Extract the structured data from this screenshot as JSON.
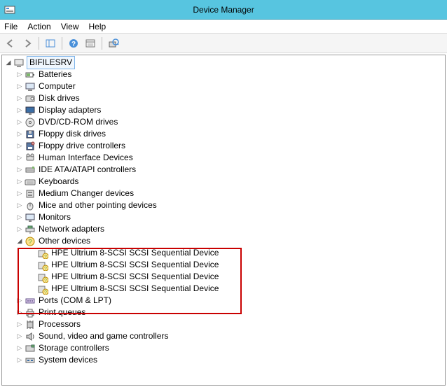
{
  "title": "Device Manager",
  "menu": {
    "file": "File",
    "action": "Action",
    "view": "View",
    "help": "Help"
  },
  "root": "BIFILESRV",
  "categories": [
    {
      "label": "Batteries",
      "icon": "battery",
      "expanded": false
    },
    {
      "label": "Computer",
      "icon": "computer",
      "expanded": false
    },
    {
      "label": "Disk drives",
      "icon": "disk",
      "expanded": false
    },
    {
      "label": "Display adapters",
      "icon": "display",
      "expanded": false
    },
    {
      "label": "DVD/CD-ROM drives",
      "icon": "optical",
      "expanded": false
    },
    {
      "label": "Floppy disk drives",
      "icon": "floppy",
      "expanded": false
    },
    {
      "label": "Floppy drive controllers",
      "icon": "floppyctrl",
      "expanded": false
    },
    {
      "label": "Human Interface Devices",
      "icon": "hid",
      "expanded": false
    },
    {
      "label": "IDE ATA/ATAPI controllers",
      "icon": "ide",
      "expanded": false
    },
    {
      "label": "Keyboards",
      "icon": "keyboard",
      "expanded": false
    },
    {
      "label": "Medium Changer devices",
      "icon": "medium",
      "expanded": false
    },
    {
      "label": "Mice and other pointing devices",
      "icon": "mouse",
      "expanded": false
    },
    {
      "label": "Monitors",
      "icon": "monitor",
      "expanded": false
    },
    {
      "label": "Network adapters",
      "icon": "network",
      "expanded": false
    },
    {
      "label": "Other devices",
      "icon": "other",
      "expanded": true,
      "children": [
        {
          "label": "HPE Ultrium 8-SCSI SCSI Sequential Device",
          "icon": "unknown"
        },
        {
          "label": "HPE Ultrium 8-SCSI SCSI Sequential Device",
          "icon": "unknown"
        },
        {
          "label": "HPE Ultrium 8-SCSI SCSI Sequential Device",
          "icon": "unknown"
        },
        {
          "label": "HPE Ultrium 8-SCSI SCSI Sequential Device",
          "icon": "unknown"
        }
      ]
    },
    {
      "label": "Ports (COM & LPT)",
      "icon": "ports",
      "expanded": false
    },
    {
      "label": "Print queues",
      "icon": "print",
      "expanded": false
    },
    {
      "label": "Processors",
      "icon": "cpu",
      "expanded": false
    },
    {
      "label": "Sound, video and game controllers",
      "icon": "sound",
      "expanded": false
    },
    {
      "label": "Storage controllers",
      "icon": "storage",
      "expanded": false
    },
    {
      "label": "System devices",
      "icon": "system",
      "expanded": false
    }
  ]
}
